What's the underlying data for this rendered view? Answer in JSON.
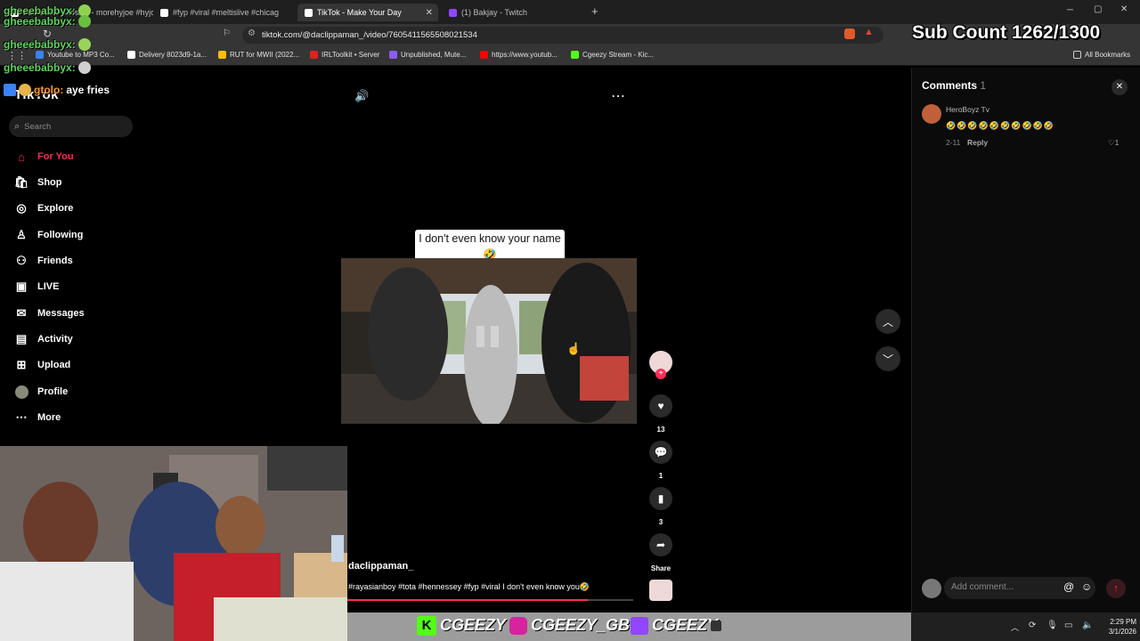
{
  "browser": {
    "tabs": [
      {
        "label": "Full studio session - morehyjoe #hyjo",
        "icon_color": "#ffffff"
      },
      {
        "label": "#fyp #viral #meltislive #chicag",
        "icon_color": "#ffffff"
      },
      {
        "label": "TikTok - Make Your Day",
        "icon_color": "#ffffff"
      },
      {
        "label": "(1) Bakjay - Twitch",
        "icon_color": "#9146ff"
      }
    ],
    "new_tab_glyph": "+",
    "url": "tiktok.com/@daclippaman_/video/7605411565508021534",
    "bookmarks": [
      {
        "label": "Youtube to MP3 Co...",
        "color": "#3b82f6"
      },
      {
        "label": "Delivery 8023d9-1a...",
        "color": "#ffffff"
      },
      {
        "label": "RUT for MWII (2022...",
        "color": "#fbbc04"
      },
      {
        "label": "IRLToolkit • Server",
        "color": "#e02020"
      },
      {
        "label": "Unpublished, Mute...",
        "color": "#8b5cf6"
      },
      {
        "label": "https://www.youtub...",
        "color": "#ff0000"
      },
      {
        "label": "Cgeezy Stream - Kic...",
        "color": "#53fc18"
      }
    ],
    "all_bookmarks": "All Bookmarks"
  },
  "overlay": {
    "sub_count": "Sub Count 1262/1300",
    "chat": [
      {
        "user": "gheeebabbyx:",
        "msg": ""
      },
      {
        "user": "gheeebabbyx:",
        "msg": ""
      },
      {
        "user": "gheeebabbyx:",
        "msg": ""
      },
      {
        "user": "gtolo:",
        "msg": "aye fries"
      }
    ],
    "banner_names": [
      "CGEEZY",
      "CGEEZY_GBC",
      "CGEEZY"
    ]
  },
  "tiktok": {
    "logo": "TikTok",
    "search_placeholder": "Search",
    "nav": [
      {
        "label": "For You",
        "icon": "home-icon",
        "glyph": "⌂"
      },
      {
        "label": "Shop",
        "icon": "shop-icon",
        "glyph": "🛍"
      },
      {
        "label": "Explore",
        "icon": "compass-icon",
        "glyph": "◎"
      },
      {
        "label": "Following",
        "icon": "following-icon",
        "glyph": "♙"
      },
      {
        "label": "Friends",
        "icon": "friends-icon",
        "glyph": "⚇"
      },
      {
        "label": "LIVE",
        "icon": "live-icon",
        "glyph": "▣"
      },
      {
        "label": "Messages",
        "icon": "messages-icon",
        "glyph": "✉"
      },
      {
        "label": "Activity",
        "icon": "activity-icon",
        "glyph": "▤"
      },
      {
        "label": "Upload",
        "icon": "upload-icon",
        "glyph": "⊞"
      },
      {
        "label": "Profile",
        "icon": "profile-icon",
        "glyph": "●"
      },
      {
        "label": "More",
        "icon": "more-icon",
        "glyph": "⋯"
      }
    ],
    "video": {
      "caption_overlay": "I don't even know your name🤣",
      "author": "daclippaman_",
      "description": "#rayasianboy #tota #hennessey #fyp #viral I don't even know you🤣",
      "likes": "13",
      "comments": "1",
      "saves": "3",
      "share_label": "Share"
    },
    "comments_panel": {
      "title": "Comments",
      "count": "1",
      "items": [
        {
          "user": "HeroBoyz Tv",
          "text": "🤣🤣🤣🤣🤣🤣🤣🤣🤣🤣",
          "date": "2-11",
          "reply": "Reply",
          "likes": "1"
        }
      ],
      "input_placeholder": "Add comment..."
    }
  },
  "taskbar": {
    "time": "2:29 PM",
    "date": "3/1/2026"
  }
}
